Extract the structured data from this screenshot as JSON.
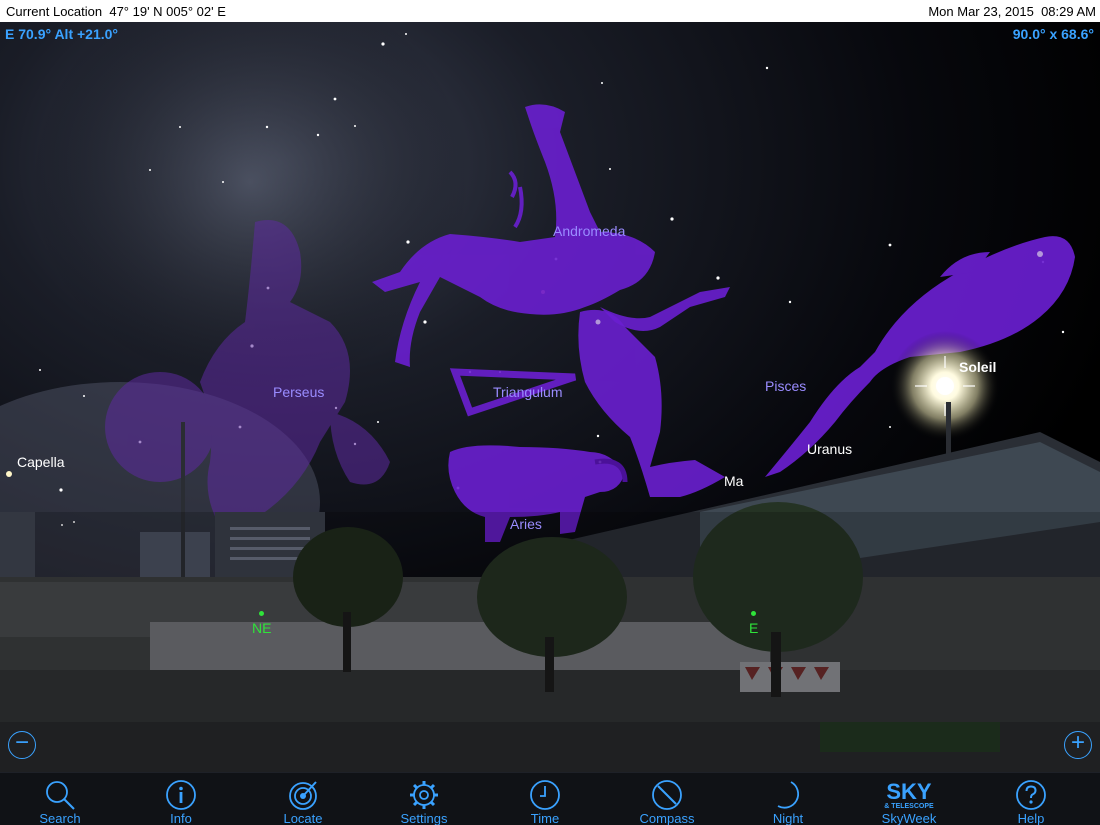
{
  "status": {
    "location": "Current Location  47° 19' N 005° 02' E",
    "datetime": "Mon Mar 23, 2015  08:29 AM"
  },
  "hud": {
    "pointing": "E 70.9° Alt +21.0°",
    "field_of_view": "90.0° x 68.6°"
  },
  "constellations": [
    "Andromeda",
    "Perseus",
    "Triangulum",
    "Aries",
    "Pisces"
  ],
  "objects": {
    "capella": "Capella",
    "soleil": "Soleil",
    "uranus": "Uranus",
    "mars_partial": "Ma"
  },
  "compass": {
    "ne": "NE",
    "e": "E"
  },
  "zoom": {
    "out": "−",
    "in": "+"
  },
  "toolbar": [
    {
      "label": "Search",
      "icon": "search-icon"
    },
    {
      "label": "Info",
      "icon": "info-icon"
    },
    {
      "label": "Locate",
      "icon": "locate-icon"
    },
    {
      "label": "Settings",
      "icon": "settings-gear-icon"
    },
    {
      "label": "Time",
      "icon": "clock-icon"
    },
    {
      "label": "Compass",
      "icon": "compass-icon"
    },
    {
      "label": "Night",
      "icon": "moon-icon"
    },
    {
      "label": "SkyWeek",
      "icon": "sky-telescope-logo"
    },
    {
      "label": "Help",
      "icon": "help-icon"
    }
  ],
  "skyweek_logo_text": "SKY",
  "skyweek_logo_subtext": "& TELESCOPE",
  "colors": {
    "accent": "#3aa2ff",
    "constellation": "#9a8cff",
    "compass": "#2fe33a",
    "figure": "#6a1fd0"
  }
}
